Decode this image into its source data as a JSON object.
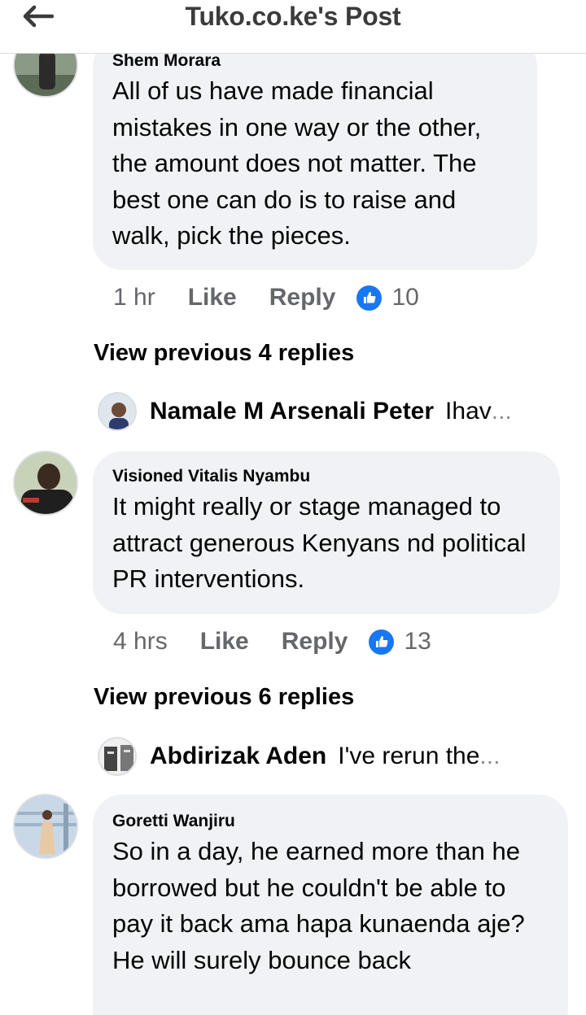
{
  "header": {
    "title": "Tuko.co.ke's Post",
    "back_icon": "back-arrow-icon"
  },
  "colors": {
    "bubble": "#f0f2f5",
    "like_blue": "#1877f2",
    "meta_gray": "#65676b"
  },
  "comments": [
    {
      "author": "Shem Morara",
      "text": "All of us have made financial mistakes in one way or the other, the amount does not matter. The best one can do is to raise and walk, pick the pieces.",
      "time": "1 hr",
      "like": "Like",
      "reply": "Reply",
      "reactions": "10",
      "view_previous": "View previous 4 replies",
      "latest_reply": {
        "name": "Namale M Arsenali Peter",
        "snippet": "Ihav",
        "ellipsis": "..."
      }
    },
    {
      "author": "Visioned Vitalis Nyambu",
      "text": "It might really or stage managed to attract generous Kenyans nd political PR interventions.",
      "time": "4 hrs",
      "like": "Like",
      "reply": "Reply",
      "reactions": "13",
      "view_previous": "View previous 6 replies",
      "latest_reply": {
        "name": "Abdirizak Aden",
        "snippet": "I've rerun the",
        "ellipsis": "..."
      }
    },
    {
      "author": "Goretti Wanjiru",
      "text": "So in a day, he earned more than he borrowed but he couldn't be able to pay it back ama hapa kunaenda aje?",
      "text2": "He will surely bounce back"
    }
  ]
}
